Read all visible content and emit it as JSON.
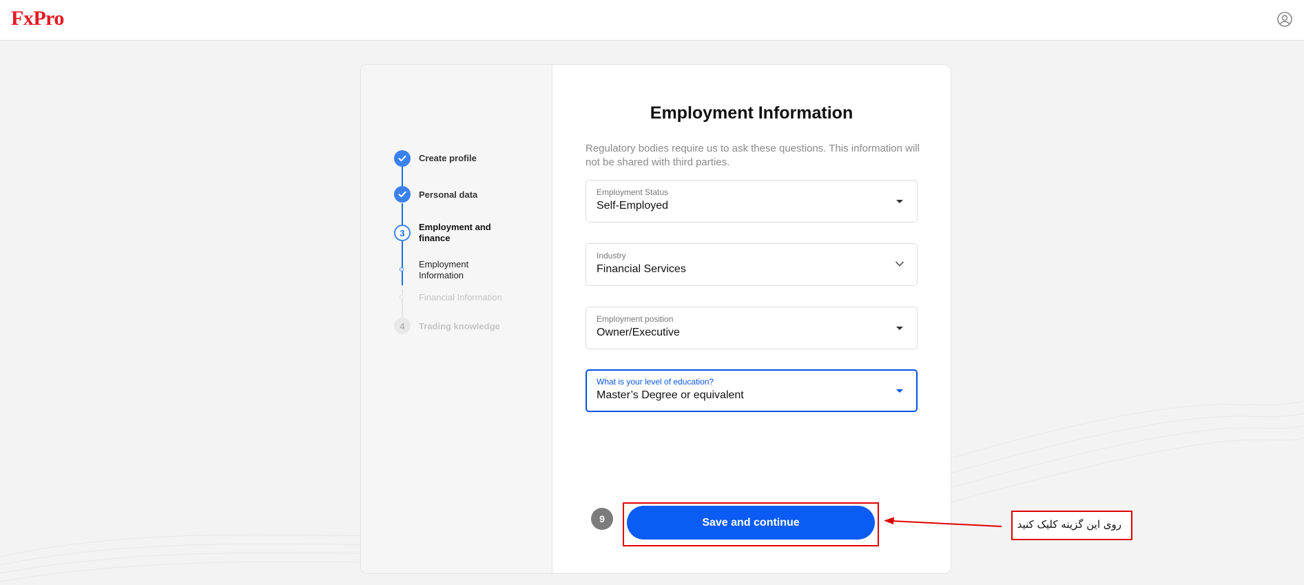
{
  "header": {
    "logo": "FxPro",
    "user_icon": "user-circle-icon"
  },
  "stepper": {
    "steps": [
      {
        "label": "Create profile",
        "state": "done"
      },
      {
        "label": "Personal data",
        "state": "done"
      },
      {
        "number": "3",
        "label": "Employment and finance",
        "state": "current"
      },
      {
        "label": "Employment Information",
        "state": "current-sub"
      },
      {
        "label": "Financial Information",
        "state": "pending-sub"
      },
      {
        "number": "4",
        "label": "Trading knowledge",
        "state": "pending"
      }
    ]
  },
  "form": {
    "title": "Employment Information",
    "description": "Regulatory bodies require us to ask these questions. This information will not be shared with third parties.",
    "fields": [
      {
        "label": "Employment Status",
        "value": "Self-Employed"
      },
      {
        "label": "Industry",
        "value": "Financial Services"
      },
      {
        "label": "Employment position",
        "value": "Owner/Executive"
      },
      {
        "label": "What is your level of education?",
        "value": "Master’s Degree or equivalent"
      }
    ],
    "save_label": "Save and continue"
  },
  "annotation": {
    "step_number": "9",
    "callout_text": "روی این گزینه کلیک کنید",
    "highlight_color": "#e00000"
  },
  "colors": {
    "brand": "#e31b23",
    "primary": "#0a5cf5",
    "step_active": "#3b82f0"
  }
}
